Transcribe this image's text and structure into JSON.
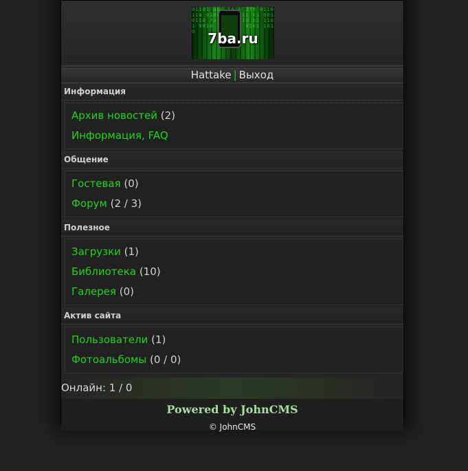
{
  "logo": {
    "text": "7ba.ru",
    "code": "01101 abc 1010 3f9 0110 11a 0100 xd 1011 01 001 0110 7a 1001 010 b2 1101 0010 1101 e4 0101 1010"
  },
  "userbar": {
    "user": "Hattake",
    "separator": "|",
    "logout": "Выход"
  },
  "sections": [
    {
      "title": "Информация",
      "items": [
        {
          "label": "Архив новостей",
          "count": "(2)"
        },
        {
          "label": "Информация, FAQ",
          "count": ""
        }
      ]
    },
    {
      "title": "Общение",
      "items": [
        {
          "label": "Гостевая",
          "count": "(0)"
        },
        {
          "label": "Форум",
          "count": "(2 / 3)"
        }
      ]
    },
    {
      "title": "Полезное",
      "items": [
        {
          "label": "Загрузки",
          "count": "(1)"
        },
        {
          "label": "Библиотека",
          "count": "(10)"
        },
        {
          "label": "Галерея",
          "count": "(0)"
        }
      ]
    },
    {
      "title": "Актив сайта",
      "items": [
        {
          "label": "Пользователи",
          "count": "(1)"
        },
        {
          "label": "Фотоальбомы",
          "count": "(0 / 0)"
        }
      ]
    }
  ],
  "online": "Онлайн: 1 / 0",
  "footer": {
    "powered": "Powered by JohnCMS",
    "copyright": "© JohnCMS"
  },
  "colors": {
    "link": "#22d41c",
    "background": "#232323"
  }
}
